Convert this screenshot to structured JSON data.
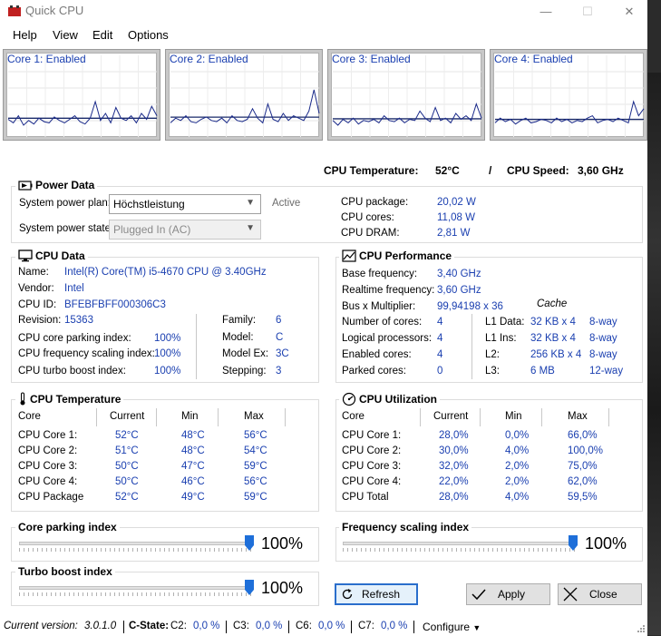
{
  "window": {
    "title": "Quick CPU",
    "minimize": "—",
    "maximize": "☐",
    "close": "✕"
  },
  "menu": [
    "Help",
    "View",
    "Edit",
    "Options"
  ],
  "cores": [
    {
      "label": "Core 1: Enabled",
      "series": [
        15,
        12,
        18,
        10,
        14,
        11,
        16,
        13,
        12,
        17,
        14,
        12,
        15,
        18,
        13,
        11,
        16,
        30,
        14,
        20,
        12,
        25,
        16,
        14,
        18,
        12,
        20,
        15,
        26,
        18
      ]
    },
    {
      "label": "Core 2: Enabled",
      "series": [
        12,
        16,
        14,
        18,
        13,
        12,
        15,
        17,
        14,
        13,
        16,
        12,
        18,
        14,
        13,
        15,
        24,
        16,
        12,
        28,
        15,
        13,
        20,
        14,
        18,
        16,
        14,
        22,
        40,
        20
      ]
    },
    {
      "label": "Core 3: Enabled",
      "series": [
        14,
        10,
        15,
        12,
        16,
        11,
        14,
        13,
        15,
        12,
        18,
        14,
        13,
        16,
        12,
        15,
        14,
        22,
        16,
        13,
        25,
        14,
        16,
        12,
        20,
        15,
        18,
        14,
        28,
        16
      ]
    },
    {
      "label": "Core 4: Enabled",
      "series": [
        12,
        16,
        13,
        15,
        11,
        14,
        16,
        12,
        13,
        15,
        14,
        12,
        16,
        13,
        15,
        12,
        14,
        13,
        16,
        18,
        12,
        14,
        15,
        13,
        16,
        14,
        12,
        30,
        18,
        24
      ]
    }
  ],
  "summary": {
    "temp_label": "CPU Temperature:",
    "temp_value": "52°C",
    "sep": "/",
    "speed_label": "CPU Speed:",
    "speed_value": "3,60 GHz"
  },
  "power": {
    "title": "Power Data",
    "plan_label": "System power plan:",
    "plan_value": "Höchstleistung",
    "plan_status": "Active",
    "state_label": "System power state:",
    "state_value": "Plugged In (AC)",
    "rows": [
      {
        "label": "CPU package:",
        "value": "20,02 W"
      },
      {
        "label": "CPU cores:",
        "value": "11,08 W"
      },
      {
        "label": "CPU DRAM:",
        "value": "2,81 W"
      }
    ]
  },
  "cpu_data": {
    "title": "CPU Data",
    "name_label": "Name:",
    "name_value": "Intel(R) Core(TM) i5-4670 CPU @ 3.40GHz",
    "vendor_label": "Vendor:",
    "vendor_value": "Intel",
    "id_label": "CPU ID:",
    "id_value": "BFEBFBFF000306C3",
    "revision_label": "Revision:",
    "revision_value": "15363",
    "parking_label": "CPU core parking index:",
    "parking_value": "100%",
    "freq_label": "CPU frequency scaling index:",
    "freq_value": "100%",
    "turbo_label": "CPU turbo boost index:",
    "turbo_value": "100%",
    "family_label": "Family:",
    "family_value": "6",
    "model_label": "Model:",
    "model_value": "C",
    "modelex_label": "Model Ex:",
    "modelex_value": "3C",
    "stepping_label": "Stepping:",
    "stepping_value": "3"
  },
  "perf": {
    "title": "CPU Performance",
    "base_label": "Base frequency:",
    "base_value": "3,40 GHz",
    "real_label": "Realtime frequency:",
    "real_value": "3,60 GHz",
    "bus_label": "Bus x Multiplier:",
    "bus_value": "99,94198 x 36",
    "cache_title": "Cache",
    "cores_label": "Number of cores:",
    "cores_value": "4",
    "logical_label": "Logical processors:",
    "logical_value": "4",
    "enabled_label": "Enabled cores:",
    "enabled_value": "4",
    "parked_label": "Parked cores:",
    "parked_value": "0",
    "cache": [
      {
        "label": "L1 Data:",
        "size": "32 KB x 4",
        "way": "8-way"
      },
      {
        "label": "L1 Ins:",
        "size": "32 KB x 4",
        "way": "8-way"
      },
      {
        "label": "L2:",
        "size": "256 KB x 4",
        "way": "8-way"
      },
      {
        "label": "L3:",
        "size": "6 MB",
        "way": "12-way"
      }
    ]
  },
  "temperature": {
    "title": "CPU Temperature",
    "headers": [
      "Core",
      "Current",
      "Min",
      "Max"
    ],
    "rows": [
      [
        "CPU Core 1:",
        "52°C",
        "48°C",
        "56°C"
      ],
      [
        "CPU Core 2:",
        "51°C",
        "48°C",
        "54°C"
      ],
      [
        "CPU Core 3:",
        "50°C",
        "47°C",
        "59°C"
      ],
      [
        "CPU Core 4:",
        "50°C",
        "46°C",
        "56°C"
      ],
      [
        "CPU Package",
        "52°C",
        "49°C",
        "59°C"
      ]
    ]
  },
  "utilization": {
    "title": "CPU Utilization",
    "headers": [
      "Core",
      "Current",
      "Min",
      "Max"
    ],
    "rows": [
      [
        "CPU Core 1:",
        "28,0%",
        "0,0%",
        "66,0%"
      ],
      [
        "CPU Core 2:",
        "30,0%",
        "4,0%",
        "100,0%"
      ],
      [
        "CPU Core 3:",
        "32,0%",
        "2,0%",
        "75,0%"
      ],
      [
        "CPU Core 4:",
        "22,0%",
        "2,0%",
        "62,0%"
      ],
      [
        "CPU Total",
        "28,0%",
        "4,0%",
        "59,5%"
      ]
    ]
  },
  "sliders": {
    "parking": {
      "title": "Core parking index",
      "value": "100%",
      "level": 1.0
    },
    "frequency": {
      "title": "Frequency scaling index",
      "value": "100%",
      "level": 1.0
    },
    "turbo": {
      "title": "Turbo boost index",
      "value": "100%",
      "level": 1.0
    }
  },
  "buttons": {
    "refresh": "Refresh",
    "apply": "Apply",
    "close": "Close"
  },
  "status": {
    "version_label": "Current version:",
    "version_value": "3.0.1.0",
    "cstate_label": "C-State:",
    "c2_label": "C2:",
    "c2_value": "0,0 %",
    "c3_label": "C3:",
    "c3_value": "0,0 %",
    "c6_label": "C6:",
    "c6_value": "0,0 %",
    "c7_label": "C7:",
    "c7_value": "0,0 %",
    "configure": "Configure"
  },
  "colors": {
    "accent": "#1a3fb0",
    "graph_line": "#1a2a8a",
    "slider": "#1e6fd9",
    "focus": "#2a6ecc"
  }
}
